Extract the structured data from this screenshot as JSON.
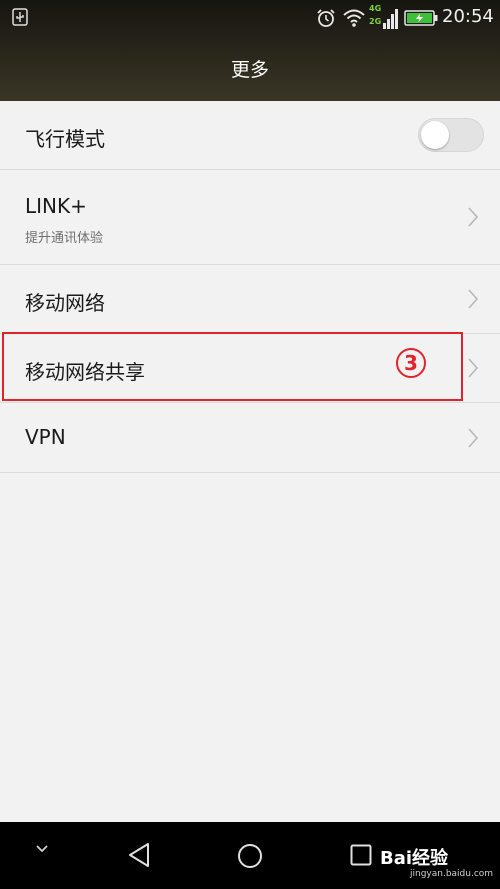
{
  "status_bar": {
    "time": "20:54",
    "network_top": "4G",
    "network_bottom": "2G",
    "icons": [
      "usb-icon",
      "alarm-icon",
      "wifi-icon",
      "signal-icon",
      "battery-icon"
    ]
  },
  "header": {
    "title": "更多"
  },
  "settings": {
    "airplane": {
      "label": "飞行模式",
      "toggle_on": false
    },
    "link_plus": {
      "label": "LINK+",
      "subtitle": "提升通讯体验"
    },
    "mobile_network": {
      "label": "移动网络"
    },
    "tethering": {
      "label": "移动网络共享"
    },
    "vpn": {
      "label": "VPN"
    }
  },
  "annotation": {
    "marker": "3",
    "color": "#e0242b"
  },
  "nav_bar": {
    "icons": [
      "chevron-down-icon",
      "back-icon",
      "home-icon",
      "recents-icon"
    ]
  },
  "watermark": {
    "brand": "Bai经验",
    "url": "jingyan.baidu.com"
  }
}
